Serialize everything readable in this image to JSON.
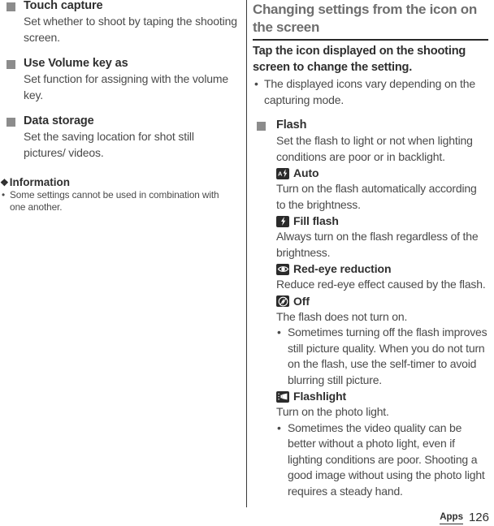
{
  "left_column": {
    "settings": [
      {
        "title": "Touch capture",
        "desc": "Set whether to shoot by taping the shooting screen."
      },
      {
        "title": "Use Volume key as",
        "desc": "Set function for assigning with the volume key."
      },
      {
        "title": "Data storage",
        "desc": "Set the saving location for shot still pictures/ videos."
      }
    ],
    "information": {
      "diamond": "❖",
      "heading": "Information",
      "bullet_symbol": "•",
      "items": [
        "Some settings cannot be used in combination with one another."
      ]
    }
  },
  "right_column": {
    "section_heading": "Changing settings from the icon on the screen",
    "lead": "Tap the icon displayed on the shooting screen to change the setting.",
    "bullet_symbol": "•",
    "lead_bullets": [
      "The displayed icons vary depending on the capturing mode."
    ],
    "flash": {
      "title": "Flash",
      "desc": "Set the flash to light or not when lighting conditions are poor or in backlight.",
      "options": [
        {
          "icon": "flash-auto-icon",
          "label": "Auto",
          "desc": "Turn on the flash automatically according to the brightness."
        },
        {
          "icon": "flash-fill-icon",
          "label": "Fill flash",
          "desc": "Always turn on the flash regardless of the brightness."
        },
        {
          "icon": "red-eye-icon",
          "label": "Red-eye reduction",
          "desc": "Reduce red-eye effect caused by the flash."
        },
        {
          "icon": "flash-off-icon",
          "label": "Off",
          "desc": "The flash does not turn on.",
          "notes": [
            "Sometimes turning off the flash improves still picture quality. When you do not turn on the flash, use the self-timer to avoid blurring still picture."
          ]
        },
        {
          "icon": "flashlight-icon",
          "label": "Flashlight",
          "desc": "Turn on the photo light.",
          "notes": [
            "Sometimes the video quality can be better without a photo light, even if lighting conditions are poor. Shooting a good image without using the photo light requires a steady hand."
          ]
        }
      ]
    }
  },
  "footer": {
    "label": "Apps",
    "page_number": "126"
  },
  "colors": {
    "bullet_square": "#8c8c8c",
    "section_heading": "#6e6e6e",
    "body_text": "#4a4a4a",
    "icon_chip": "#2b2b2b"
  }
}
